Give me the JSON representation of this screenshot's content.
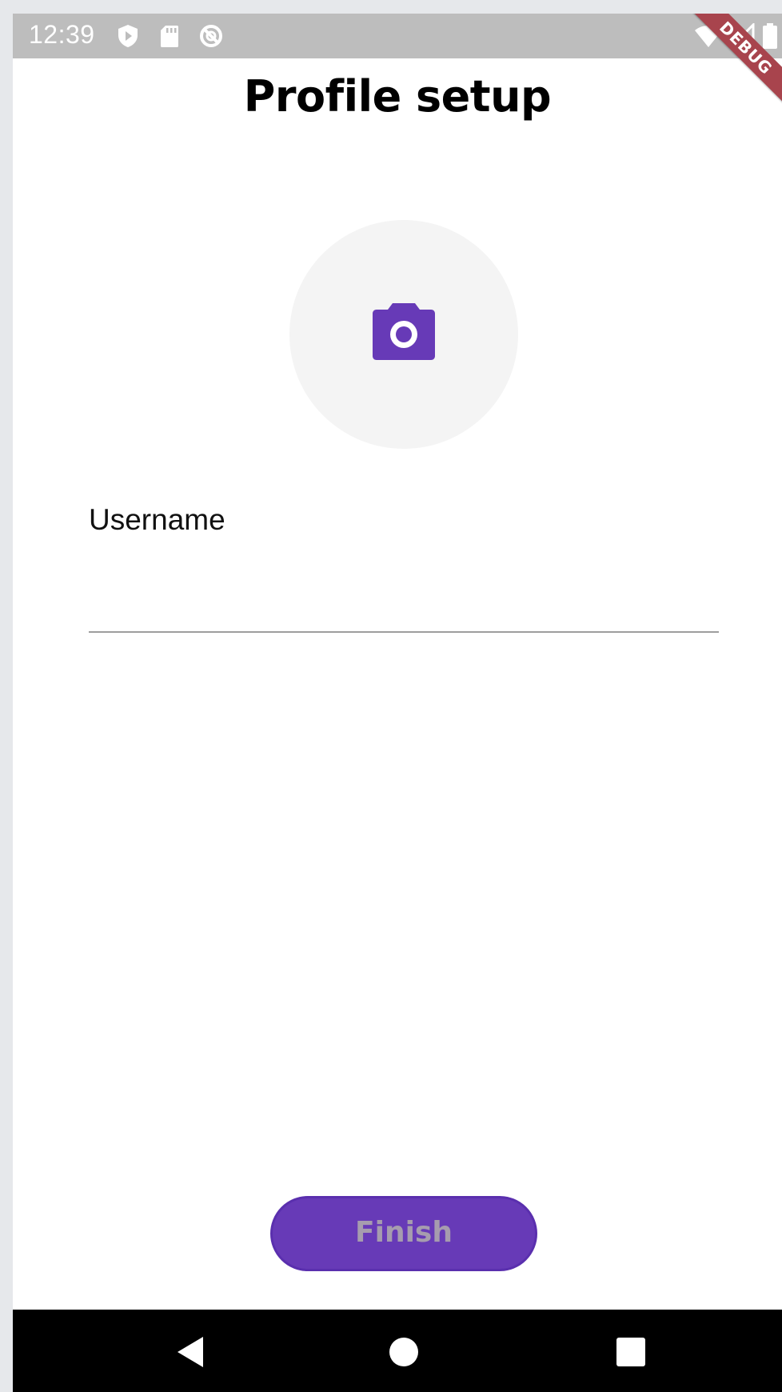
{
  "status_bar": {
    "time": "12:39",
    "left_icons": [
      "shield-play-icon",
      "sd-card-icon",
      "sync-disabled-icon"
    ],
    "right_icons": [
      "wifi-icon",
      "cell-signal-icon",
      "battery-icon"
    ]
  },
  "debug_banner": {
    "label": "DEBUG"
  },
  "page": {
    "title": "Profile setup"
  },
  "avatar": {
    "icon": "camera-icon",
    "icon_color": "#673ab7",
    "background": "#f4f4f4"
  },
  "username": {
    "label": "Username",
    "value": "",
    "placeholder": ""
  },
  "finish_button": {
    "label": "Finish",
    "background": "#673ab7",
    "text_color": "#a69cae"
  },
  "nav_bar": {
    "icons": [
      "back-icon",
      "home-icon",
      "recents-icon"
    ]
  }
}
